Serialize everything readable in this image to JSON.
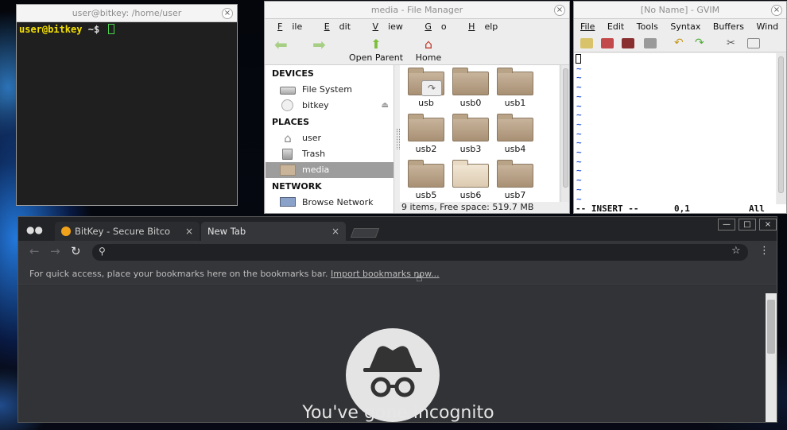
{
  "terminal": {
    "title": "user@bitkey: /home/user",
    "prompt_user": "user@bitkey",
    "prompt_tail": "~$",
    "close": "×"
  },
  "file_manager": {
    "title": "media - File Manager",
    "close": "×",
    "menu": [
      "File",
      "Edit",
      "View",
      "Go",
      "Help"
    ],
    "menu_hotkeys": [
      "F",
      "E",
      "V",
      "G",
      "H"
    ],
    "toolbar": {
      "back": "Back",
      "forward": "Forward",
      "open_parent": "Open Parent",
      "home": "Home"
    },
    "sidebar": {
      "devices_header": "DEVICES",
      "devices": [
        {
          "label": "File System",
          "icon": "drive-icon"
        },
        {
          "label": "bitkey",
          "icon": "disc-icon"
        }
      ],
      "places_header": "PLACES",
      "places": [
        {
          "label": "user",
          "icon": "home-icon"
        },
        {
          "label": "Trash",
          "icon": "trash-icon"
        },
        {
          "label": "media",
          "icon": "folder-icon",
          "selected": true
        }
      ],
      "network_header": "NETWORK",
      "network": [
        {
          "label": "Browse Network",
          "icon": "network-icon"
        }
      ]
    },
    "folders": [
      "usb",
      "usb0",
      "usb1",
      "usb2",
      "usb3",
      "usb4",
      "usb5",
      "usb6",
      "usb7"
    ],
    "status": "9 items, Free space: 519.7 MB"
  },
  "gvim": {
    "title": "[No Name] - GVIM",
    "close": "×",
    "menu": [
      "File",
      "Edit",
      "Tools",
      "Syntax",
      "Buffers",
      "Wind"
    ],
    "menu_hotkeys": [
      "F",
      "E",
      "T",
      "S",
      "B",
      "W"
    ],
    "tilde": "~",
    "mode": "-- INSERT --",
    "position": "0,1",
    "scroll": "All"
  },
  "chrome": {
    "tabs": [
      {
        "title": "BitKey - Secure Bitco",
        "close": "×"
      },
      {
        "title": "New Tab",
        "close": "×"
      }
    ],
    "window_controls": {
      "minimize": "—",
      "maximize": "□",
      "close": "×"
    },
    "bookmarks_text": "For quick access, place your bookmarks here on the bookmarks bar.",
    "import_link": "Import bookmarks now...",
    "headline": "You've gone incognito"
  },
  "colors": {
    "prompt_user": "#f4e000",
    "vim_tilde": "#2c57d6",
    "chrome_bg": "#35363a"
  }
}
